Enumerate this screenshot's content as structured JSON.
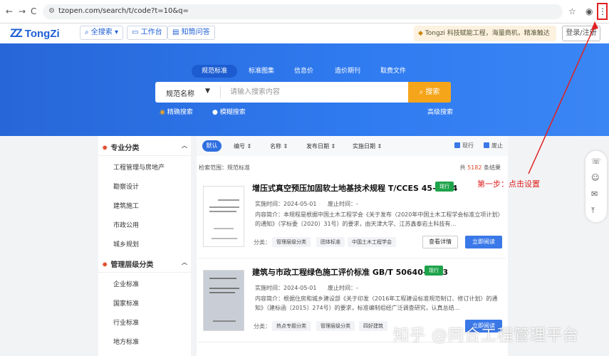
{
  "browser": {
    "url": "tzopen.com/search/t/code?t=10&q=",
    "back": "←",
    "forward": "→",
    "reload": "C"
  },
  "site": {
    "logo": "TongZi",
    "search_all": "全搜索",
    "workbench": "工作台",
    "qa": "知筒问答",
    "promo": "Tongzi 科技赋能工程，海量商机，精准触达",
    "login": "登录/注册"
  },
  "hero": {
    "tabs": [
      "规范标准",
      "标准图集",
      "信息价",
      "造价期刊",
      "取费文件"
    ],
    "select_value": "规范名称",
    "placeholder": "请输入搜索内容",
    "search_button": "搜索",
    "opt_exact": "精确搜索",
    "opt_fuzzy": "模糊搜索",
    "advanced": "高级搜索"
  },
  "sidebar": {
    "group1": "专业分类",
    "group1_items": [
      "工程管理与房地产",
      "勘察设计",
      "建筑施工",
      "市政公用",
      "城乡规划"
    ],
    "group2": "管理层级分类",
    "group2_items": [
      "企业标准",
      "国家标准",
      "行业标准",
      "地方标准"
    ]
  },
  "results": {
    "sort": {
      "default": "默认",
      "items": [
        "编号",
        "名称",
        "发布日期",
        "实施日期"
      ],
      "check_current": "现行",
      "check_abolished": "废止"
    },
    "scope": "检索范围：规范标准",
    "count_prefix": "共",
    "count": "5182",
    "count_suffix": "条结果",
    "cards": [
      {
        "title": "增压式真空预压加固软土地基技术规程 T/CCES 45-2024",
        "badge": "现行",
        "impl": "实施时间：2024-05-01",
        "abol": "废止时间：-",
        "desc": "内容简介：本规程是根据中国土木工程学会《关于发布〈2020年中国土木工程学会标准立项计划〉的通知》（学标委〔2020〕31号）的要求，由天津大学、江苏鑫泰岩土科技有...",
        "cat_label": "分类：",
        "tags": [
          "管理层级分类",
          "团体标准",
          "中国土木工程学会"
        ],
        "detail": "查看详情",
        "read": "立即阅读"
      },
      {
        "title": "建筑与市政工程绿色施工评价标准 GB/T 50640-2023",
        "badge": "现行",
        "impl": "实施时间：2024-05-01",
        "abol": "废止时间：-",
        "desc": "内容简介：根据住房和城乡建设部《关于印发〈2016年工程建设标准规范制订、修订计划〉的通知》（建标函〔2015〕274号）的要求，标准编制组经广泛调查研究，认真总结...",
        "cat_label": "分类：",
        "tags": [
          "热点专题分类",
          "管理层级分类",
          "四好建筑"
        ],
        "read": "立即阅读"
      }
    ]
  },
  "annotation": "第一步：点击设置",
  "watermark": "知乎 @同合工程管理平台",
  "colors": {
    "brand": "#1e5fd4",
    "hero": "#2f7bf0",
    "accent": "#f5a51a",
    "badge": "#1ea34a",
    "annotation": "#e02020"
  }
}
